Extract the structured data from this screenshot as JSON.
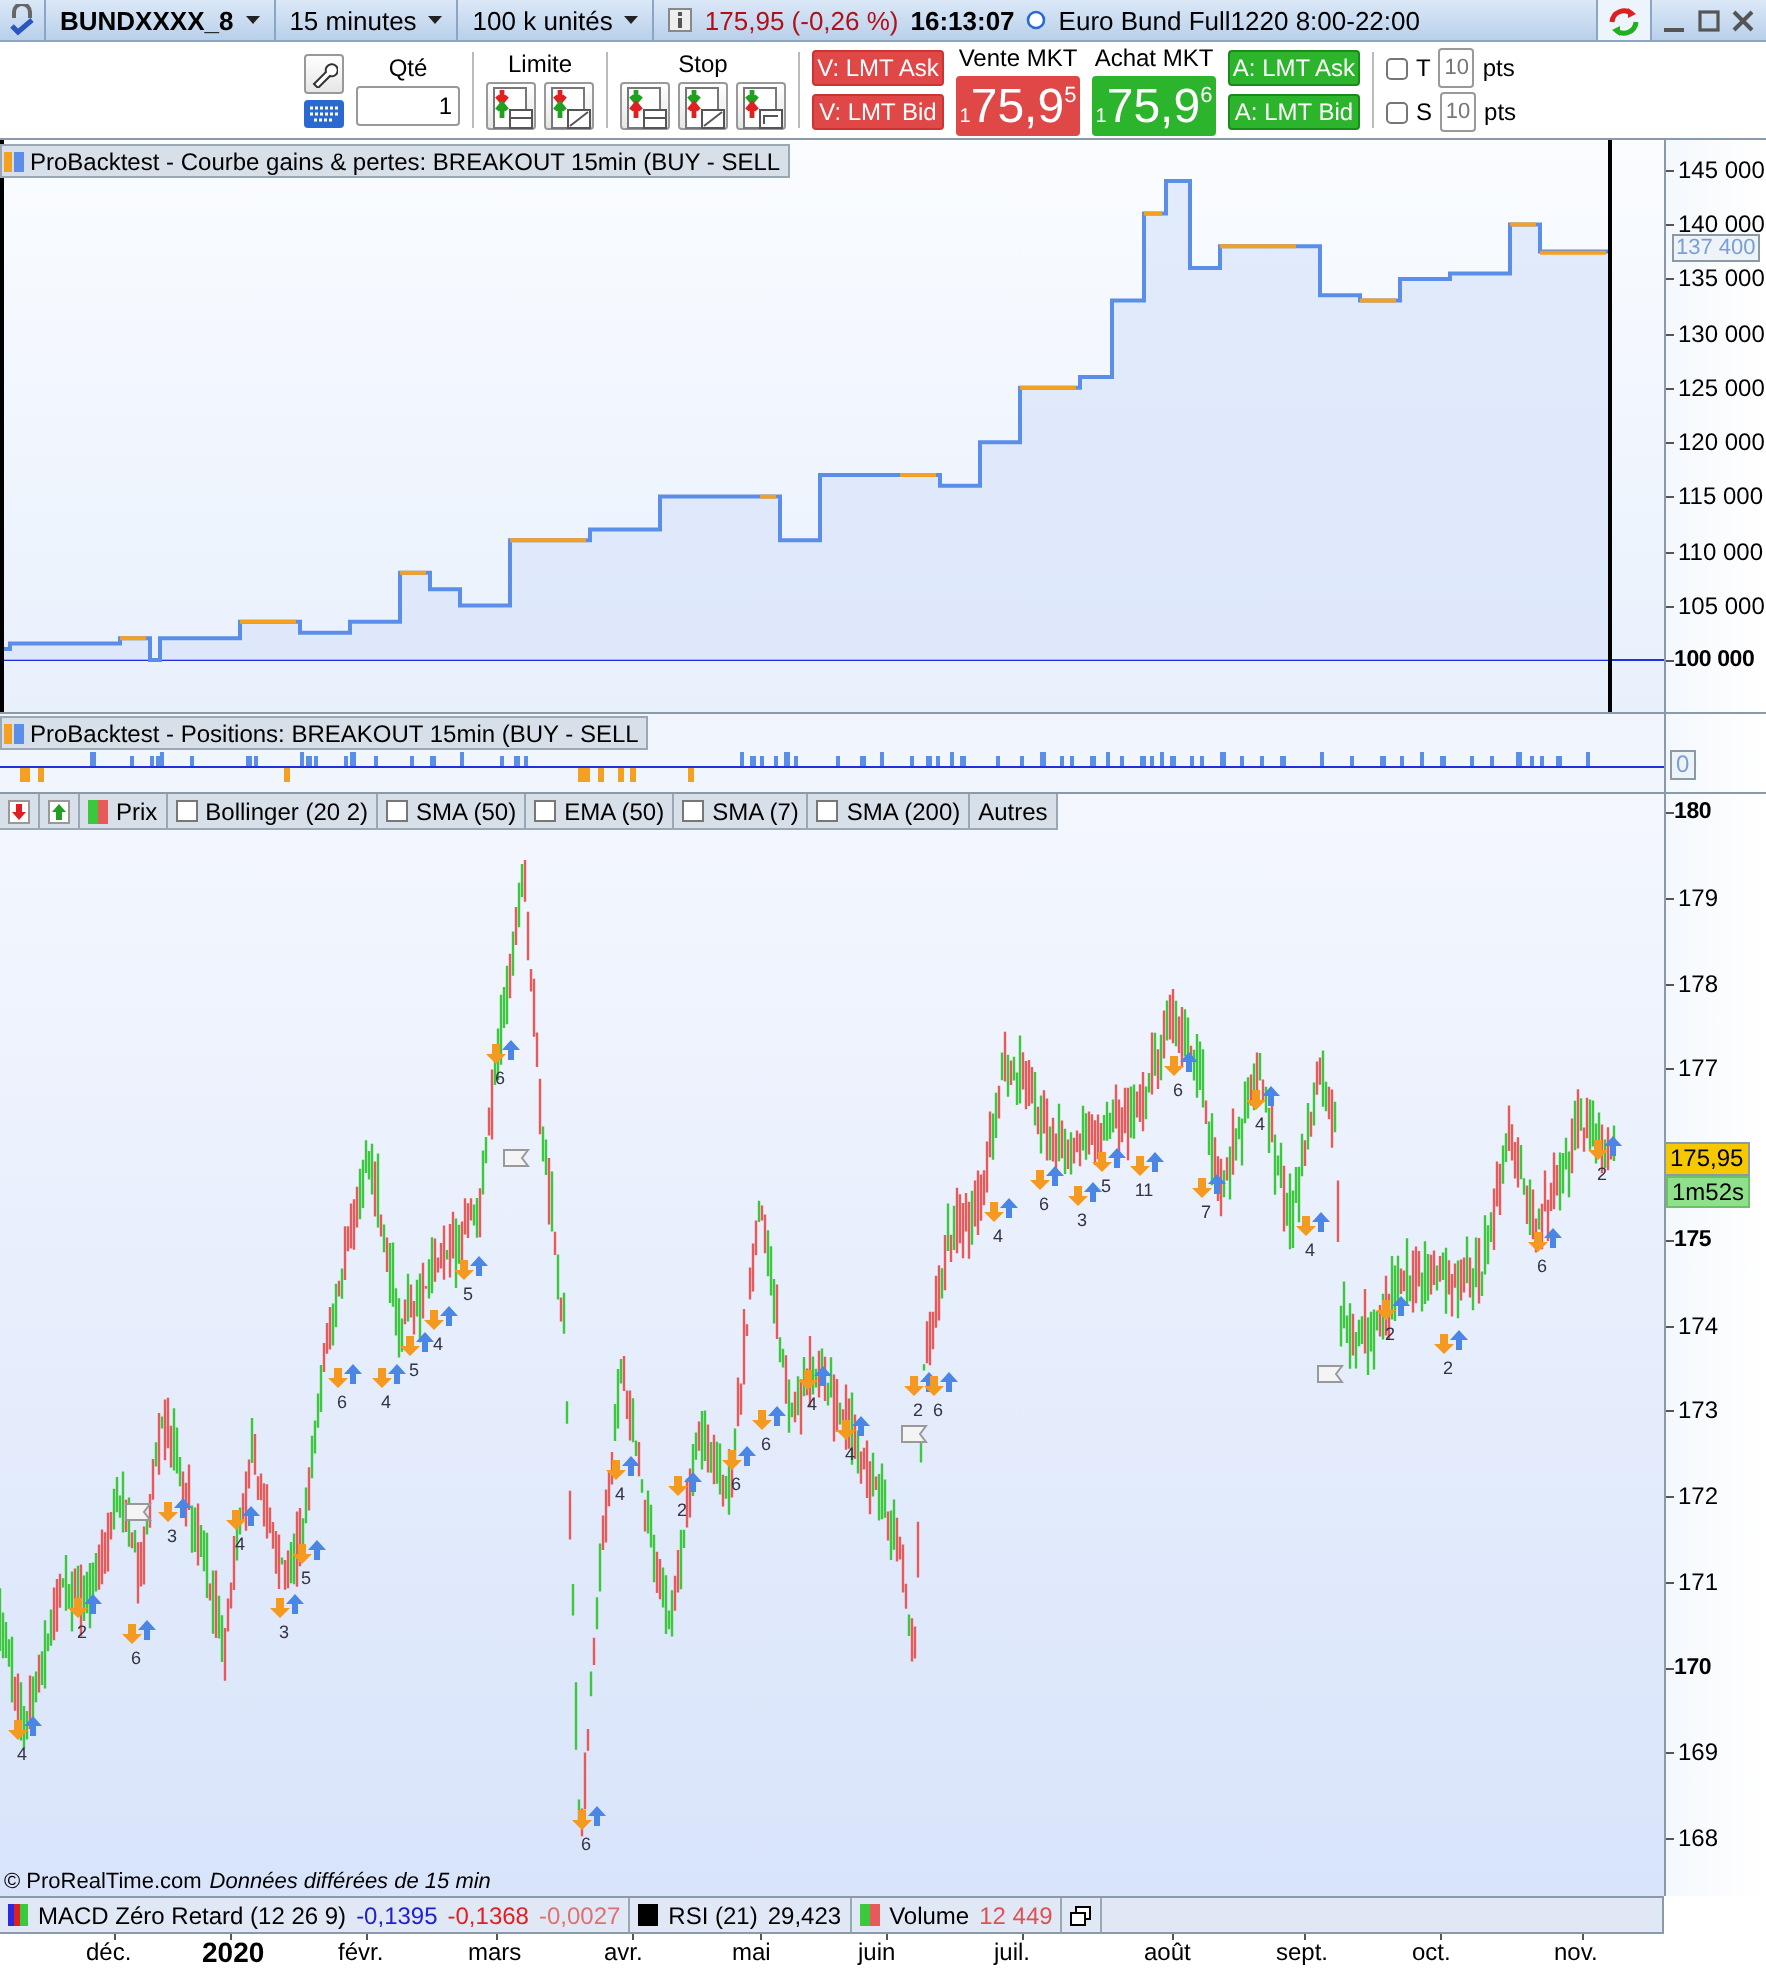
{
  "title_bar": {
    "instrument": "BUNDXXXX_8",
    "timeframe": "15 minutes",
    "size": "100 k unités",
    "price": "175,95 (-0,26 %)",
    "time": "16:13:07",
    "name": "Euro Bund Full1220 8:00-22:00"
  },
  "order_panel": {
    "qty_label": "Qté",
    "qty": "1",
    "limit_label": "Limite",
    "stop_label": "Stop",
    "sell_buttons": [
      "V: LMT Ask",
      "V: LMT Bid"
    ],
    "sell_market": {
      "label": "Vente MKT",
      "prefix": "1",
      "main": "75,9",
      "sup": "5"
    },
    "buy_market": {
      "label": "Achat MKT",
      "prefix": "1",
      "main": "75,9",
      "sup": "6"
    },
    "buy_buttons": [
      "A: LMT Ask",
      "A: LMT Bid"
    ],
    "options": [
      {
        "letter": "T",
        "checked": false,
        "value": "10",
        "unit": "pts"
      },
      {
        "letter": "S",
        "checked": false,
        "value": "10",
        "unit": "pts"
      }
    ]
  },
  "equity_panel": {
    "title": "ProBacktest - Courbe gains & pertes: BREAKOUT 15min (BUY - SELL",
    "last_value": "137 400",
    "y_ticks": [
      {
        "label": "145 000",
        "bold": false
      },
      {
        "label": "140 000",
        "bold": false
      },
      {
        "label": "135 000",
        "bold": false
      },
      {
        "label": "130 000",
        "bold": false
      },
      {
        "label": "125 000",
        "bold": false
      },
      {
        "label": "120 000",
        "bold": false
      },
      {
        "label": "115 000",
        "bold": false
      },
      {
        "label": "110 000",
        "bold": false
      },
      {
        "label": "105 000",
        "bold": false
      },
      {
        "label": "100 000",
        "bold": true
      }
    ]
  },
  "positions_panel": {
    "title": "ProBacktest - Positions: BREAKOUT 15min (BUY - SELL",
    "last_value": "0"
  },
  "price_panel": {
    "toolbar": [
      {
        "kind": "colors",
        "label": "Prix"
      },
      {
        "kind": "checkbox",
        "label": "Bollinger (20 2)",
        "checked": false
      },
      {
        "kind": "checkbox",
        "label": "SMA (50)",
        "checked": false
      },
      {
        "kind": "checkbox",
        "label": "EMA (50)",
        "checked": false
      },
      {
        "kind": "checkbox",
        "label": "SMA (7)",
        "checked": false
      },
      {
        "kind": "checkbox",
        "label": "SMA (200)",
        "checked": false
      },
      {
        "kind": "plain",
        "label": "Autres"
      }
    ],
    "y_ticks": [
      {
        "label": "180",
        "bold": true
      },
      {
        "label": "179",
        "bold": false
      },
      {
        "label": "178",
        "bold": false
      },
      {
        "label": "177",
        "bold": false
      },
      {
        "label": "175",
        "bold": true
      },
      {
        "label": "174",
        "bold": false
      },
      {
        "label": "173",
        "bold": false
      },
      {
        "label": "172",
        "bold": false
      },
      {
        "label": "171",
        "bold": false
      },
      {
        "label": "170",
        "bold": true
      },
      {
        "label": "169",
        "bold": false
      },
      {
        "label": "168",
        "bold": false
      }
    ],
    "last_price": "175,95",
    "countdown": "1m52s",
    "trade_counts": [
      "4",
      "2",
      "6",
      "3",
      "4",
      "3",
      "5",
      "6",
      "4",
      "5",
      "4",
      "5",
      "6",
      "6",
      "4",
      "2",
      "6",
      "6",
      "4",
      "4",
      "2",
      "6",
      "4",
      "6",
      "3",
      "5",
      "11",
      "6",
      "7",
      "4",
      "4",
      "2",
      "2",
      "6",
      "2"
    ],
    "copyright": "© ProRealTime.com",
    "delay_note": "Données différées de 15 min"
  },
  "indicators": [
    {
      "name": "MACD Zéro Retard (12 26 9)",
      "values": [
        {
          "text": "-0,1395",
          "color": "#2020d0"
        },
        {
          "text": "-0,1368",
          "color": "#e02020"
        },
        {
          "text": "-0,0027",
          "color": "#e07070"
        }
      ]
    },
    {
      "name": "RSI (21)",
      "values": [
        {
          "text": "29,423",
          "color": "#000000"
        }
      ]
    },
    {
      "name": "Volume",
      "values": [
        {
          "text": "12 449",
          "color": "#e05050"
        }
      ]
    }
  ],
  "x_axis": [
    {
      "label": "déc.",
      "bold": false
    },
    {
      "label": "2020",
      "bold": true
    },
    {
      "label": "févr.",
      "bold": false
    },
    {
      "label": "mars",
      "bold": false
    },
    {
      "label": "avr.",
      "bold": false
    },
    {
      "label": "mai",
      "bold": false
    },
    {
      "label": "juin",
      "bold": false
    },
    {
      "label": "juil.",
      "bold": false
    },
    {
      "label": "août",
      "bold": false
    },
    {
      "label": "sept.",
      "bold": false
    },
    {
      "label": "oct.",
      "bold": false
    },
    {
      "label": "nov.",
      "bold": false
    }
  ]
}
